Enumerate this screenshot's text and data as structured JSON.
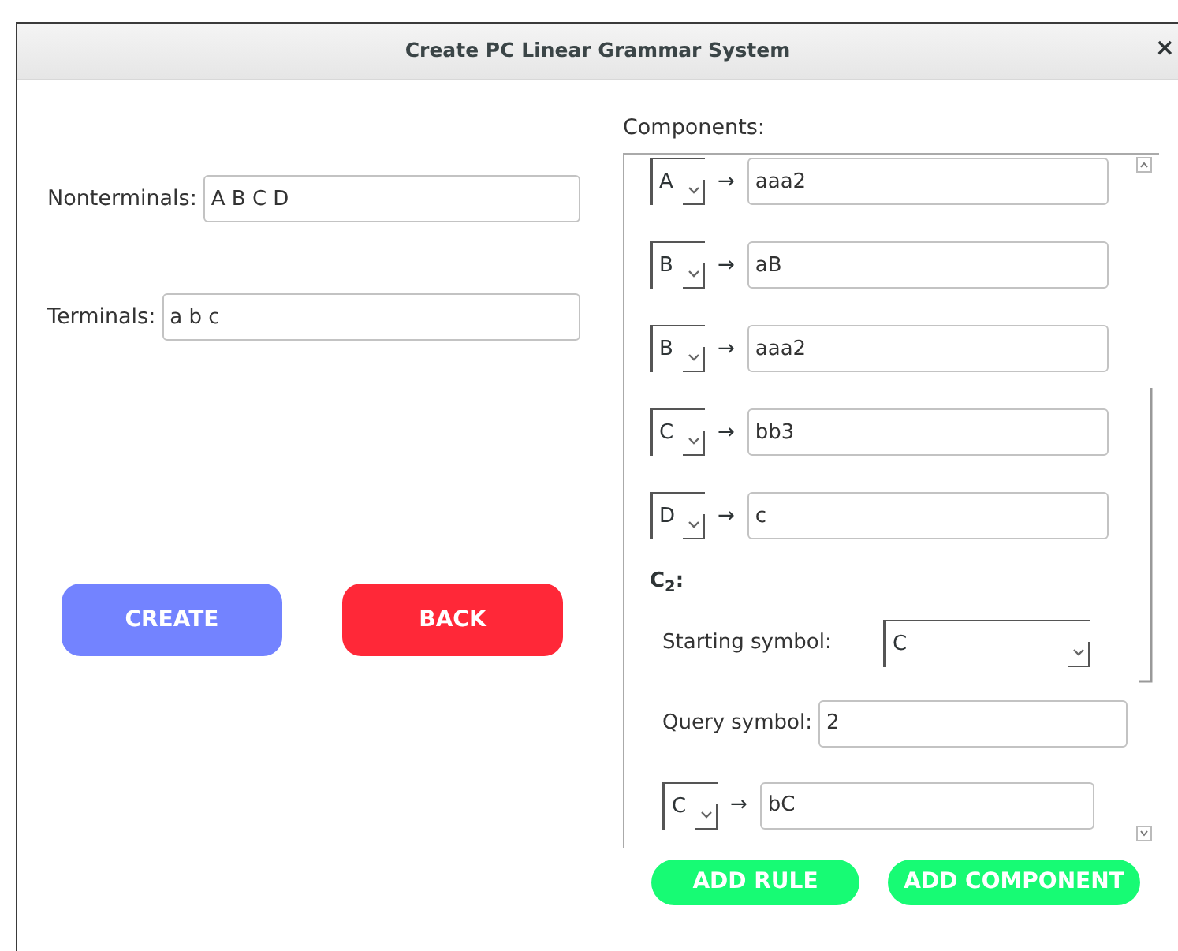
{
  "window": {
    "title": "Create PC Linear Grammar System",
    "close": "×"
  },
  "nonterminals": {
    "label": "Nonterminals:",
    "value": "A B C D"
  },
  "terminals": {
    "label": "Terminals:",
    "value": "a b c"
  },
  "buttons": [
    {
      "kind": "create",
      "label": "CREATE"
    },
    {
      "kind": "back",
      "label": "BACK"
    }
  ],
  "components": {
    "label": "Components:",
    "items": [
      {
        "kind": "rule",
        "symbol": "A",
        "arrow": "→",
        "value": "aaa2"
      },
      {
        "kind": "rule",
        "symbol": "B",
        "arrow": "→",
        "value": "aB"
      },
      {
        "kind": "rule",
        "symbol": "B",
        "arrow": "→",
        "value": "aaa2"
      },
      {
        "kind": "rule",
        "symbol": "C",
        "arrow": "→",
        "value": "bb3"
      },
      {
        "kind": "rule",
        "symbol": "D",
        "arrow": "→",
        "value": "c"
      },
      {
        "kind": "heading",
        "text": "C$_{2}$:"
      },
      {
        "kind": "start",
        "label": "Starting symbol:",
        "symbol": "C"
      },
      {
        "kind": "query",
        "label": "Query symbol:",
        "value": "2"
      },
      {
        "kind": "rule",
        "symbol": "C",
        "arrow": "→",
        "value": "bC"
      }
    ]
  },
  "actions": [
    {
      "label": "ADD RULE"
    },
    {
      "label": "ADD COMPONENT"
    }
  ]
}
